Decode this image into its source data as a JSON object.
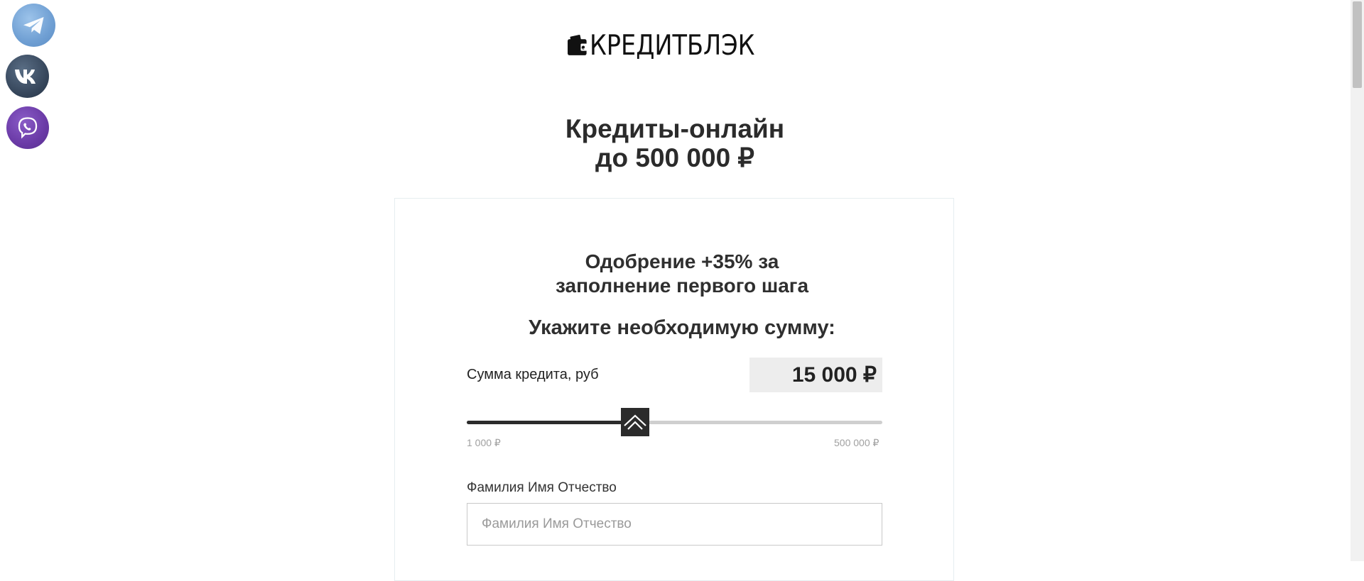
{
  "social": [
    {
      "name": "telegram",
      "icon": "telegram-icon",
      "color": "#6f9fd3"
    },
    {
      "name": "vk",
      "icon": "vk-icon",
      "color": "#35455a"
    },
    {
      "name": "viber",
      "icon": "viber-icon",
      "color": "#6a3aa6"
    }
  ],
  "logo": {
    "text": "КРЕДИТБЛЭК",
    "icon": "wallet-icon"
  },
  "hero": {
    "line1": "Кредиты-онлайн",
    "line2": "до 500 000 ₽"
  },
  "form": {
    "title_line1": "Одобрение +35% за",
    "title_line2": "заполнение первого шага",
    "subtitle": "Укажите необходимую сумму:",
    "amount_label": "Сумма кредита, руб",
    "amount_value": "15 000 ₽",
    "slider": {
      "min_label": "1 000 ₽",
      "max_label": "500 000 ₽",
      "fill_fraction": 0.4
    },
    "fio_label": "Фамилия Имя Отчество",
    "fio_placeholder": "Фамилия Имя Отчество",
    "fio_value": ""
  },
  "colors": {
    "accent": "#2b2b2b",
    "track": "#cfcfcf",
    "amount_bg": "#ededed"
  }
}
